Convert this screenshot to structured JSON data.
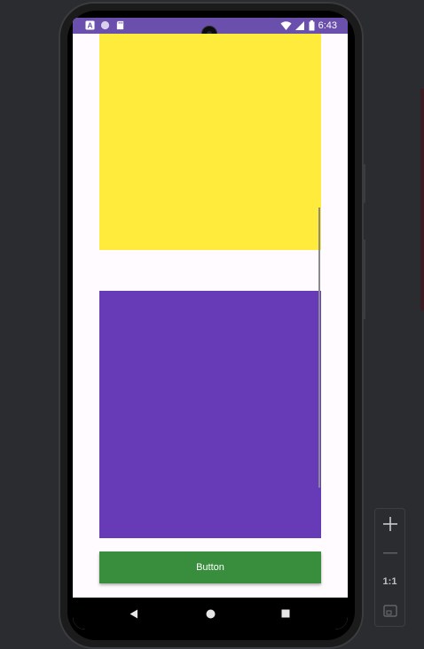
{
  "status_bar": {
    "time": "6:43",
    "left_icons": [
      "text-a-icon",
      "circle-icon",
      "sd-card-icon"
    ],
    "right_icons": [
      "wifi-icon",
      "signal-icon",
      "battery-icon"
    ],
    "background_color": "#6a4fad"
  },
  "content": {
    "yellow_box_color": "#ffeb3b",
    "purple_box_color": "#673ab7",
    "button_label": "Button",
    "button_color": "#388e3c",
    "background_color": "#fffbfe"
  },
  "nav_bar": {
    "items": [
      "back-icon",
      "home-icon",
      "recents-icon"
    ]
  },
  "emulator_controls": {
    "zoom_in": "+",
    "zoom_out": "—",
    "actual_size": "1:1",
    "fit_screen": "fit-screen-icon"
  }
}
